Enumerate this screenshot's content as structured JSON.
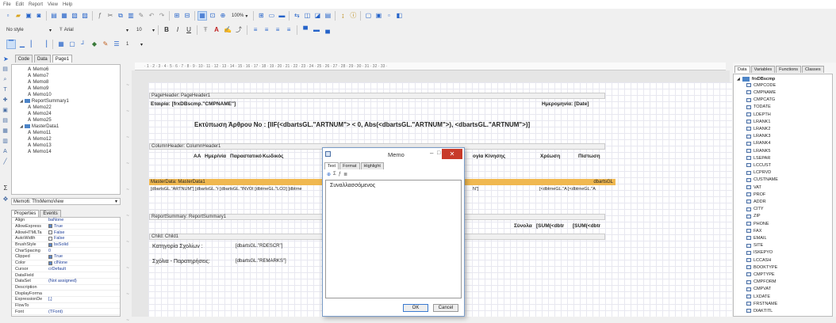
{
  "menu": [
    "File",
    "Edit",
    "Report",
    "View",
    "Help"
  ],
  "toolbar2": {
    "style": "No style",
    "font": "Arial",
    "size": "10",
    "zoom_label": "100%"
  },
  "toolbar3": {
    "size": "1"
  },
  "tabs": [
    "Code",
    "Data",
    "Page1"
  ],
  "tree": [
    "Memo6",
    "Memo7",
    "Memo8",
    "Memo9",
    "Memo10",
    "ReportSummary1",
    "Memo22",
    "Memo24",
    "Memo25",
    "MasterData1",
    "Memo11",
    "Memo12",
    "Memo13",
    "Memo14"
  ],
  "inspector": {
    "object": "Memo6: TfrxMemoView",
    "tabs": [
      "Properties",
      "Events"
    ],
    "rows": [
      {
        "name": "Align",
        "value": "baNone",
        "cb": null
      },
      {
        "name": "AllowExpress",
        "value": "True",
        "cb": true
      },
      {
        "name": "AllowHTMLTa",
        "value": "False",
        "cb": false
      },
      {
        "name": "AutoWidth",
        "value": "False",
        "cb": false
      },
      {
        "name": "BrushStyle",
        "value": "bsSolid",
        "cb": true
      },
      {
        "name": "CharSpacing",
        "value": "0",
        "cb": null
      },
      {
        "name": "Clipped",
        "value": "True",
        "cb": true
      },
      {
        "name": "Color",
        "value": "clNone",
        "cb": true
      },
      {
        "name": "Cursor",
        "value": "crDefault",
        "cb": null
      },
      {
        "name": "DataField",
        "value": "",
        "cb": null
      },
      {
        "name": "DataSet",
        "value": "(Not assigned)",
        "cb": null
      },
      {
        "name": "Description",
        "value": "",
        "cb": null
      },
      {
        "name": "DisplayForma",
        "value": "",
        "cb": null
      },
      {
        "name": "ExpressionDe",
        "value": "[,]",
        "cb": null
      },
      {
        "name": "FlowTo",
        "value": "",
        "cb": null
      },
      {
        "name": "Font",
        "value": "(TFont)",
        "cb": null
      }
    ]
  },
  "ruler": "· 1 · 2 · 3 · 4 · 5 · 6 · 7 · 8 · 9 · 10 · 11 · 12 · 13 · 14 · 15 · 16 · 17 · 18 · 19 · 20 · 21 · 22 · 23 · 24 · 25 · 26 · 27 · 28 · 29 · 30 · 31 · 32 · 33 ·",
  "report": {
    "page_header": "PageHeader: PageHeader1",
    "company": "Εταιρία: [frxDBscmp.\"CMPNAME\"]",
    "date": "Ημερομηνία: [Date]",
    "title": "Εκτύπωση Άρθρου Νο : [IIF(<dbartsGL.\"ARTNUM\"> < 0, Abs(<dbartsGL.\"ARTNUM\">), <dbartsGL.\"ARTNUM\">)]",
    "column_header": "ColumnHeader: ColumnHeader1",
    "col_aa": "ΑΑ",
    "col_date": "Ημερ/νία",
    "col_doc": "Παραστατικό",
    "col_code": "Κωδικός",
    "col_kind": "ογία Κίνησης",
    "col_debit": "Χρέωση",
    "col_credit": "Πίστωση",
    "masterdata": "MasterData: MasterData1",
    "masterdata_ds": "dbartsGL",
    "md_fields": "[dbartsGL.\"ARTNUM\"] [dbartsGL.\"r [dbartsGL.\"INVOI [dbtrneGL.\"LCO] [dbtrne",
    "md_field_mid": "N\"]",
    "md_fields_right": "[<dbtrneGL.\"A [<dbtrneGL.\"A",
    "summary": "ReportSummary: ReportSummary1",
    "totals_label": "Σύνολα",
    "totals_val1": "[SUM(<dbtr",
    "totals_val2": "[SUM(<dbtr",
    "child": "Child: Child1",
    "cat_label": "Κατηγορία Σχολίων :",
    "cat_value": "[dbartsGL.\"RDESCR\"]",
    "remarks_label": "Σχόλια - Παρατηρήσεις:",
    "remarks_value": "[dbartsGL.\"REMARKS\"]"
  },
  "dialog": {
    "title": "Memo",
    "tabs": [
      "Text",
      "Format",
      "Highlight"
    ],
    "text": "Συναλλασσόμενος",
    "ok": "OK",
    "cancel": "Cancel"
  },
  "datapanel": {
    "tabs": [
      "Data",
      "Variables",
      "Functions",
      "Classes"
    ],
    "root": "frxDBscmp",
    "fields": [
      "CMPCODE",
      "CMPNAME",
      "CMPCATG",
      "TODATE",
      "LDEPTH",
      "LRANK1",
      "LRANK2",
      "LRANK3",
      "LRANK4",
      "LRANK5",
      "LSEPAR",
      "LCCUST",
      "LCPRVD",
      "CUSTNAME",
      "VAT",
      "PROF",
      "ADDR",
      "CITY",
      "ZIP",
      "PHONE",
      "FAX",
      "EMAIL",
      "SITE",
      "ISKEPYO",
      "LCCASH",
      "BOOKTYPE",
      "CMPTYPE",
      "CMPFORM",
      "CMPVAT",
      "LXDATE",
      "FRSTNAME",
      "DIAKTITL"
    ]
  }
}
